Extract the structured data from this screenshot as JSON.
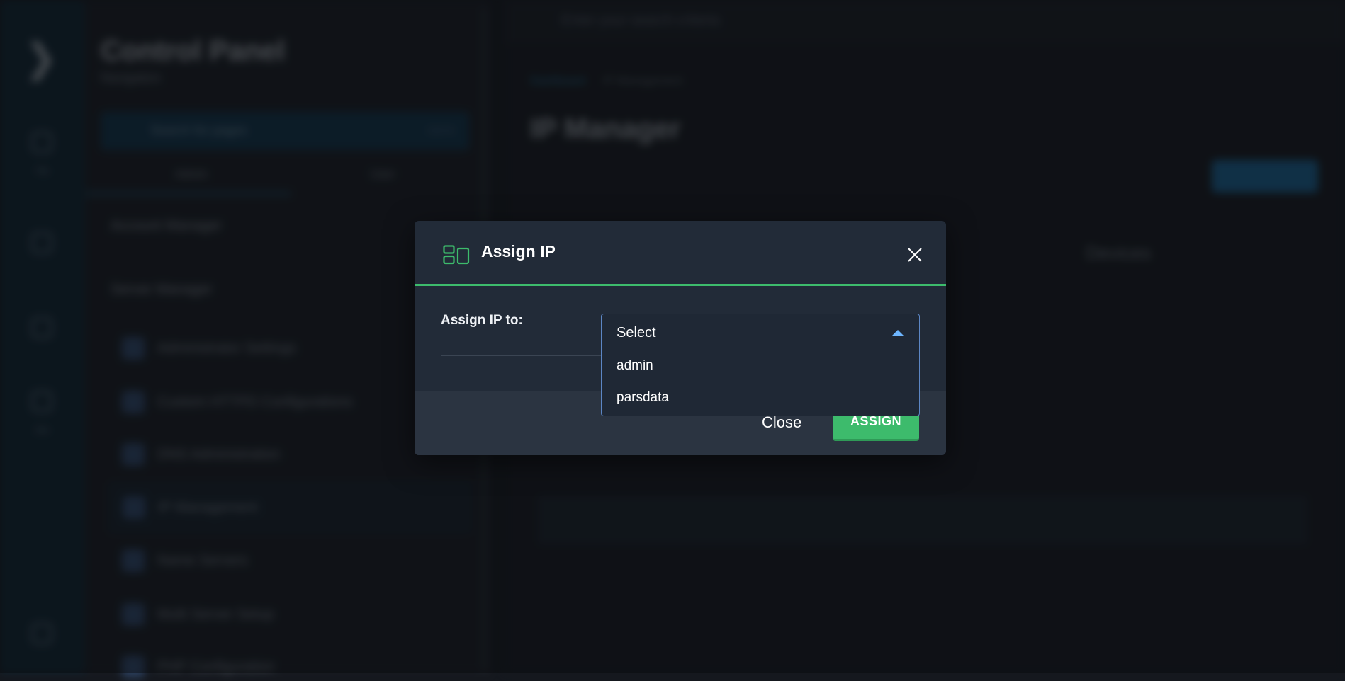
{
  "background": {
    "rail": {
      "labels": [
        "File",
        "Dev"
      ]
    },
    "nav": {
      "title": "Control Panel",
      "subtitle": "Navigation",
      "search_placeholder": "Search for pages",
      "search_shortcut": "Ctrl+K",
      "tabs": [
        "Admin",
        "User"
      ],
      "sections": [
        "Account Manager",
        "Server Manager"
      ],
      "items": [
        "Administrator Settings",
        "Custom HTTPD Configurations",
        "DNS Administration",
        "IP Management",
        "Name Servers",
        "Multi Server Setup",
        "PHP Configuration"
      ]
    },
    "main": {
      "search_placeholder": "Enter your search criteria",
      "breadcrumb": [
        "Dashboard",
        "IP Management"
      ],
      "page_title": "IP Manager",
      "devices_title": "Devices"
    }
  },
  "modal": {
    "title": "Assign IP",
    "field_label": "Assign IP to:",
    "select": {
      "value": "Select",
      "options": [
        "admin",
        "parsdata"
      ]
    },
    "close_label": "Close",
    "assign_label": "ASSIGN"
  },
  "colors": {
    "accent_green": "#3dbb6c",
    "select_border": "#5c86c4",
    "caret_blue": "#6eb6ff"
  }
}
